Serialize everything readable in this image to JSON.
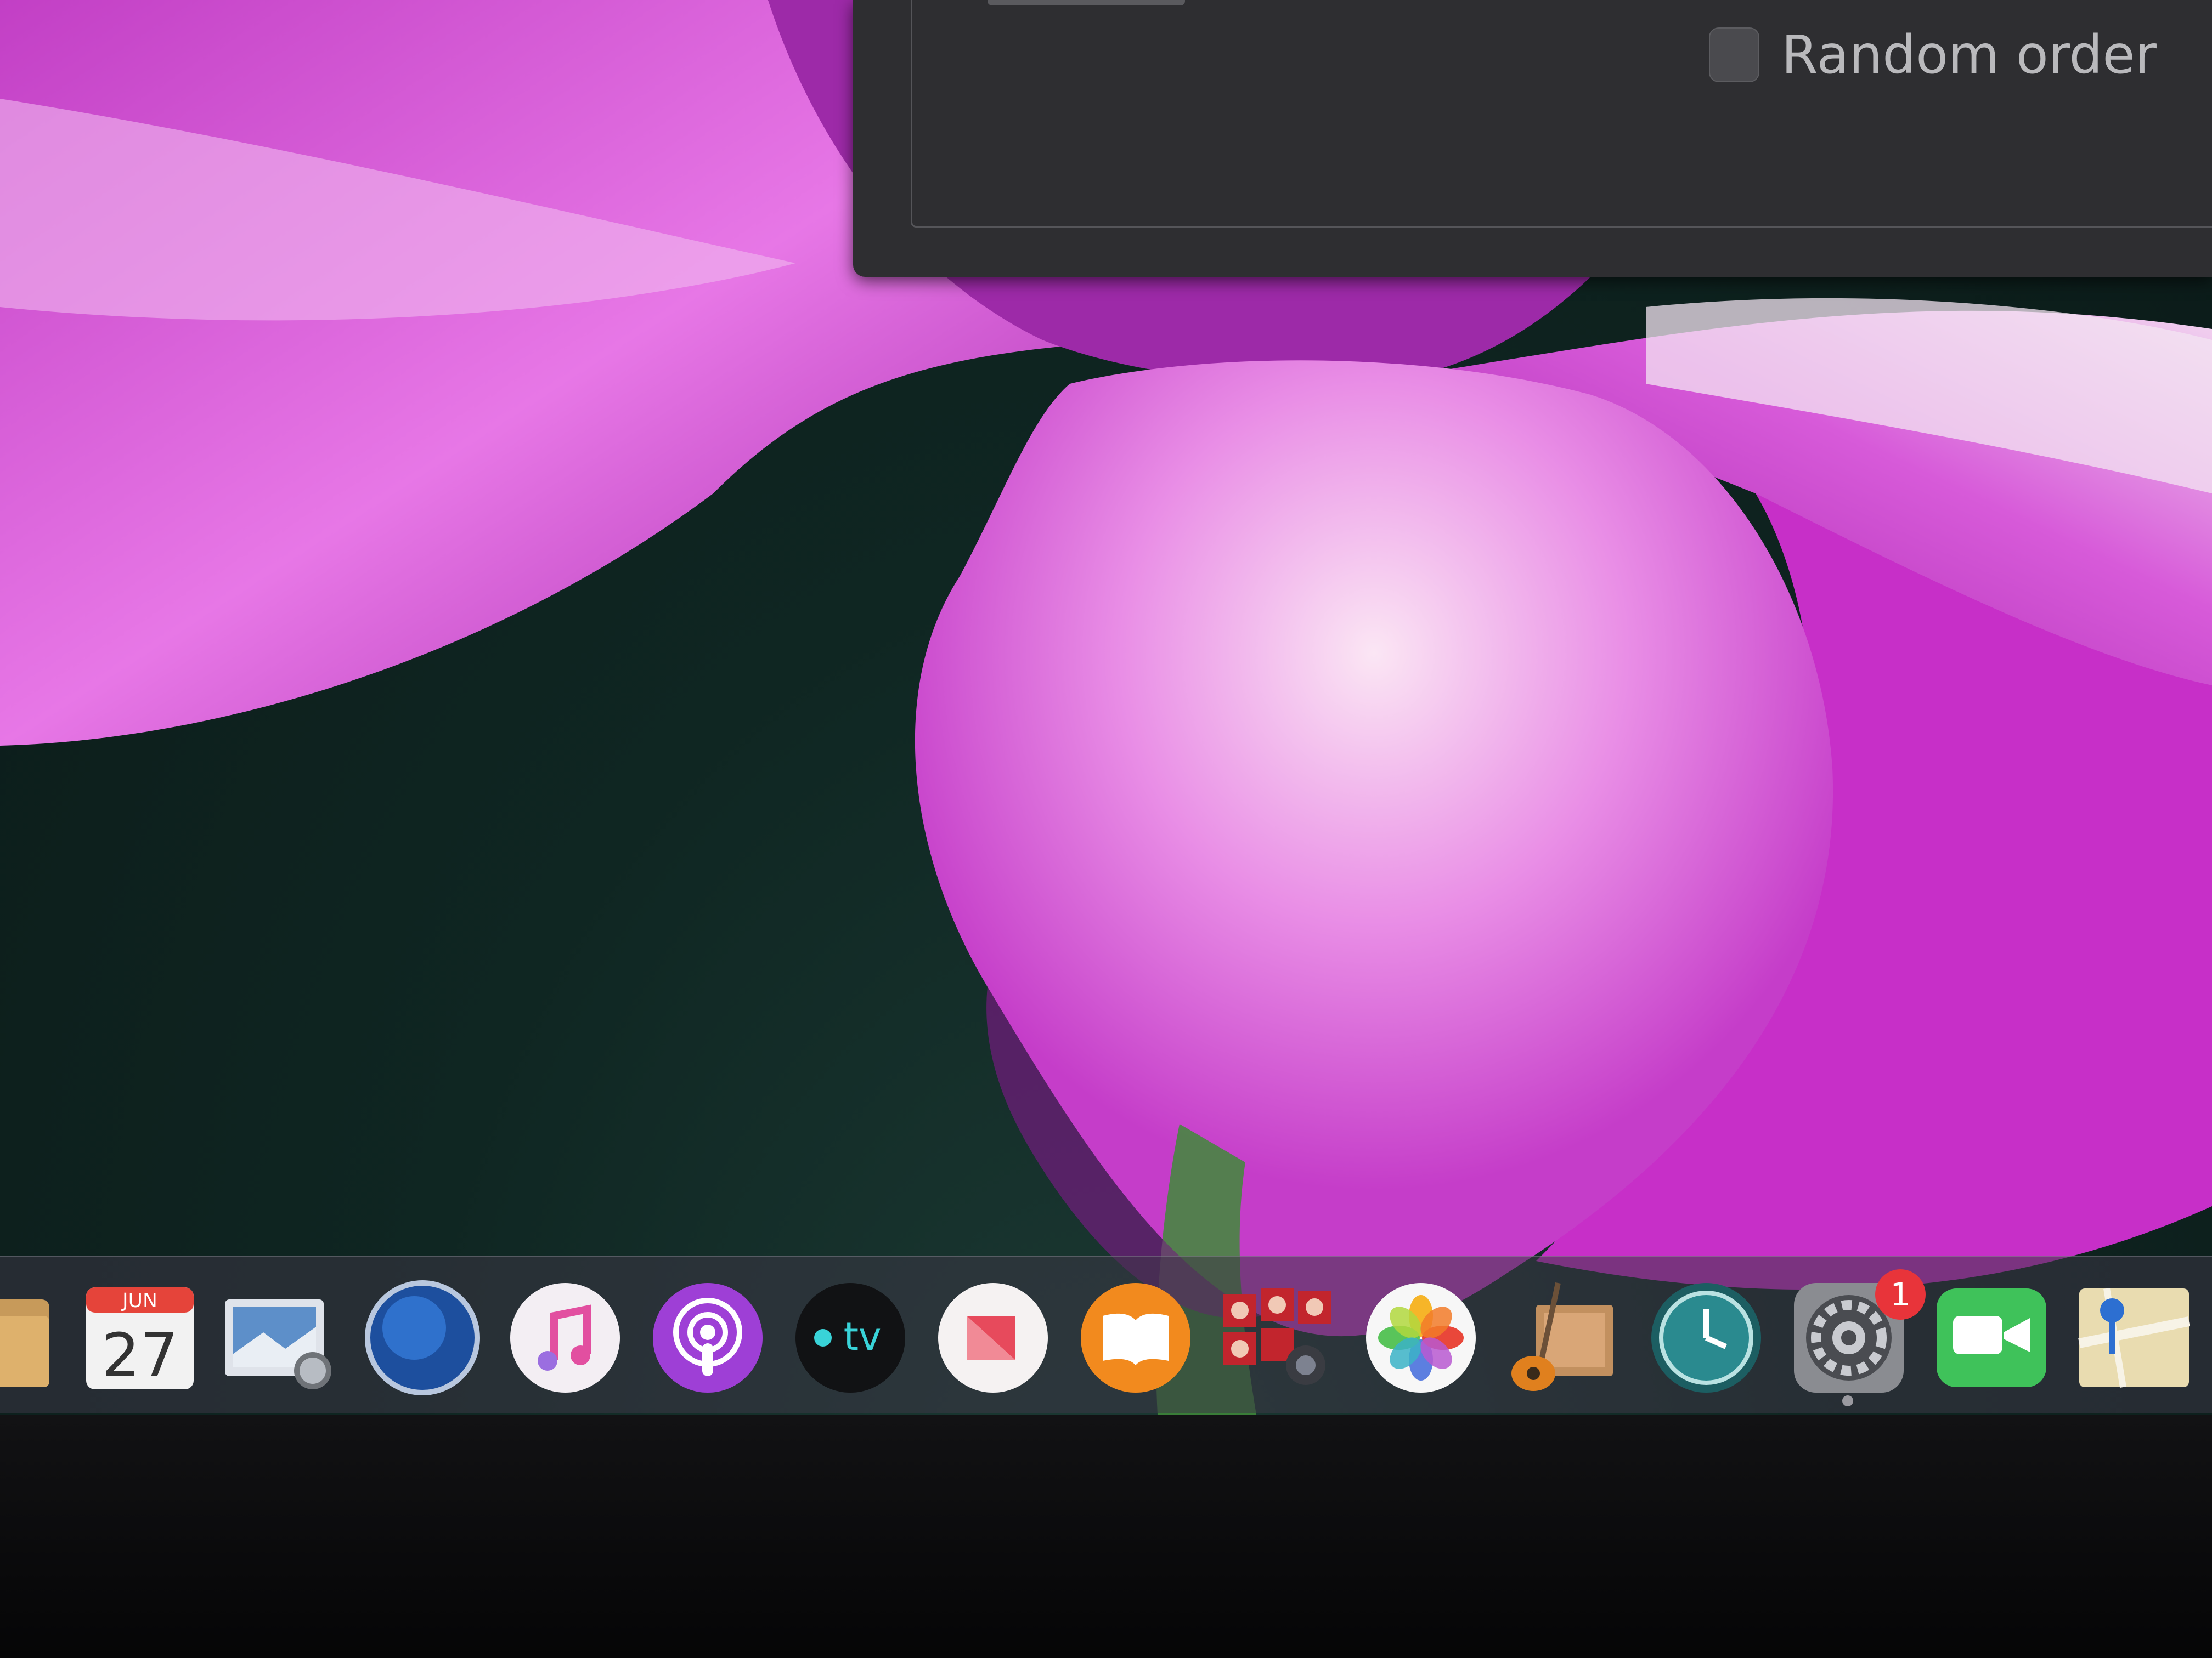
{
  "dialog": {
    "random_order_label": "Random order",
    "random_order_checked": false
  },
  "dock": {
    "items": [
      {
        "name": "finder",
        "icon": "folder-icon"
      },
      {
        "name": "calendar",
        "icon": "calendar-icon",
        "month": "JUN",
        "day": "27"
      },
      {
        "name": "preview",
        "icon": "preview-icon"
      },
      {
        "name": "sky-lab",
        "icon": "globe-icon"
      },
      {
        "name": "music",
        "icon": "music-note-icon"
      },
      {
        "name": "podcasts",
        "icon": "podcast-icon"
      },
      {
        "name": "tv",
        "icon": "apple-tv-icon",
        "label": "tv"
      },
      {
        "name": "news",
        "icon": "news-icon"
      },
      {
        "name": "books",
        "icon": "book-icon"
      },
      {
        "name": "photo-booth",
        "icon": "photo-booth-icon"
      },
      {
        "name": "photos",
        "icon": "photos-flower-icon"
      },
      {
        "name": "garageband",
        "icon": "guitar-icon"
      },
      {
        "name": "time-machine",
        "icon": "clock-icon"
      },
      {
        "name": "system-preferences",
        "icon": "gear-icon",
        "badge": "1",
        "running": true
      },
      {
        "name": "facetime",
        "icon": "video-camera-icon"
      },
      {
        "name": "maps",
        "icon": "map-icon"
      }
    ]
  },
  "colors": {
    "dock_bg": "#3c3746",
    "dialog_bg": "#2e2e31",
    "badge": "#e8343a",
    "wallpaper_petal": "#c83ad0"
  }
}
